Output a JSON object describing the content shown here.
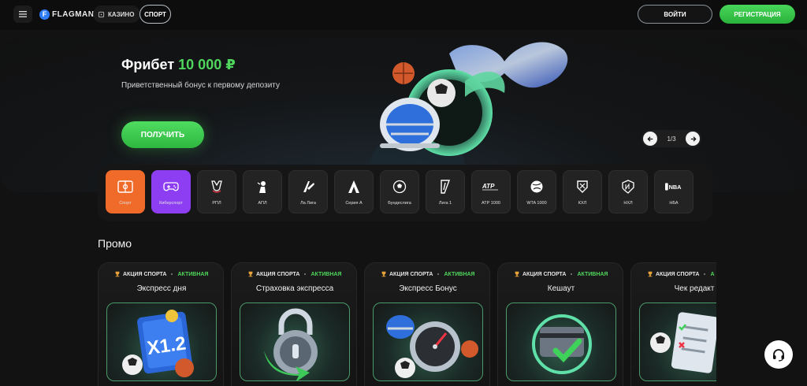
{
  "header": {
    "logo_text": "FLAGMAN",
    "logo_mark": "F",
    "nav": {
      "casino": "КАЗИНО",
      "sport": "СПОРТ"
    },
    "login": "ВОЙТИ",
    "register": "РЕГИСТРАЦИЯ"
  },
  "banner": {
    "title_prefix": "Фрибет",
    "title_amount": "10 000 ₽",
    "subtitle": "Приветственный бонус к первому депозиту",
    "cta": "ПОЛУЧИТЬ",
    "slider_count": "1/3"
  },
  "sports": [
    {
      "label": "Спорт",
      "icon": "field-icon"
    },
    {
      "label": "Киберспорт",
      "icon": "gamepad-icon"
    },
    {
      "label": "РПЛ",
      "icon": "rpl-icon"
    },
    {
      "label": "АПЛ",
      "icon": "epl-icon"
    },
    {
      "label": "Ла Лига",
      "icon": "laliga-icon"
    },
    {
      "label": "Серия А",
      "icon": "seriea-icon"
    },
    {
      "label": "Бундеслига",
      "icon": "ball-icon"
    },
    {
      "label": "Лига 1",
      "icon": "ligue1-icon"
    },
    {
      "label": "ATP 1000",
      "icon": "atp-icon"
    },
    {
      "label": "WTA 1000",
      "icon": "wta-icon"
    },
    {
      "label": "КХЛ",
      "icon": "khl-icon"
    },
    {
      "label": "НХЛ",
      "icon": "nhl-icon"
    },
    {
      "label": "НБА",
      "icon": "nba-icon"
    }
  ],
  "sport_icon_text": {
    "atp": "ATP",
    "nba": "NBA"
  },
  "promo": {
    "title": "Промо",
    "cards": [
      {
        "tag": "АКЦИЯ СПОРТА",
        "status": "АКТИВНАЯ",
        "name": "Экспресс дня",
        "art": "x12-art",
        "art_text": "X1.2"
      },
      {
        "tag": "АКЦИЯ СПОРТА",
        "status": "АКТИВНАЯ",
        "name": "Страховка экспресса",
        "art": "lock-art"
      },
      {
        "tag": "АКЦИЯ СПОРТА",
        "status": "АКТИВНАЯ",
        "name": "Экспресс Бонус",
        "art": "speedometer-art"
      },
      {
        "tag": "АКЦИЯ СПОРТА",
        "status": "АКТИВНАЯ",
        "name": "Кешаут",
        "art": "card-check-art"
      },
      {
        "tag": "АКЦИЯ СПОРТА",
        "status": "А",
        "name": "Чек редакт",
        "art": "checklist-art"
      }
    ]
  },
  "colors": {
    "accent_green": "#4fd65c",
    "orange": "#f06a2a",
    "purple": "#8d3df2",
    "background": "#121212"
  }
}
